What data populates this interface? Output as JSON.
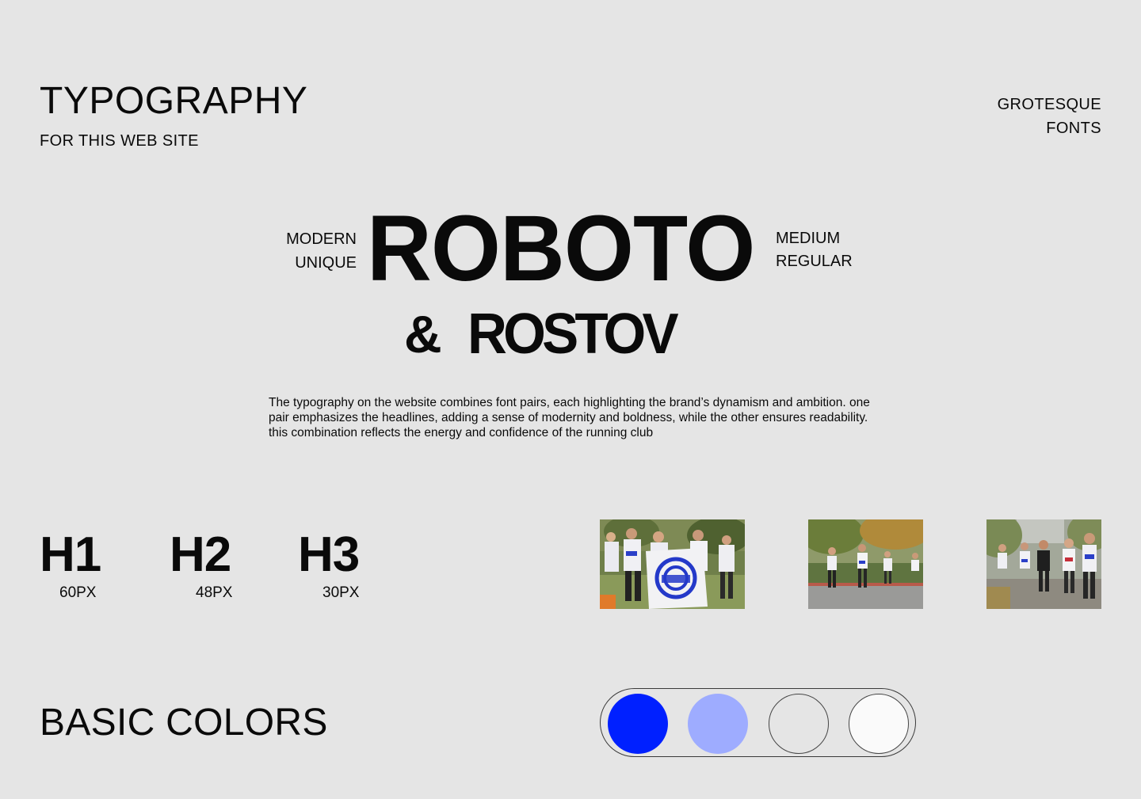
{
  "header": {
    "title": "TYPOGRAPHY",
    "subtitle": "FOR THIS WEB SITE",
    "font_kind": [
      "GROTESQUE",
      "FONTS"
    ]
  },
  "hero": {
    "left_words": [
      "MODERN",
      "UNIQUE"
    ],
    "primary_font": "ROBOTO",
    "right_words": [
      "MEDIUM",
      "REGULAR"
    ],
    "ampersand": "&",
    "secondary_font": "ROSTOV"
  },
  "description": "The typography on the website combines font pairs, each highlighting the brand’s dynamism and ambition. one pair emphasizes the headlines, adding a sense of modernity and boldness, while the other ensures readability. this combination reflects the energy and confidence of the running club",
  "headings": [
    {
      "label": "H1",
      "size": "60PX"
    },
    {
      "label": "H2",
      "size": "48PX"
    },
    {
      "label": "H3",
      "size": "30PX"
    }
  ],
  "photos": [
    {
      "subject": "runners-with-flag"
    },
    {
      "subject": "runners-on-road"
    },
    {
      "subject": "marathon-runners"
    }
  ],
  "colors": {
    "title": "BASIC COLORS",
    "swatches": [
      "#0020ff",
      "#9eacff",
      "#e5e5e5",
      "#fafafa"
    ]
  }
}
